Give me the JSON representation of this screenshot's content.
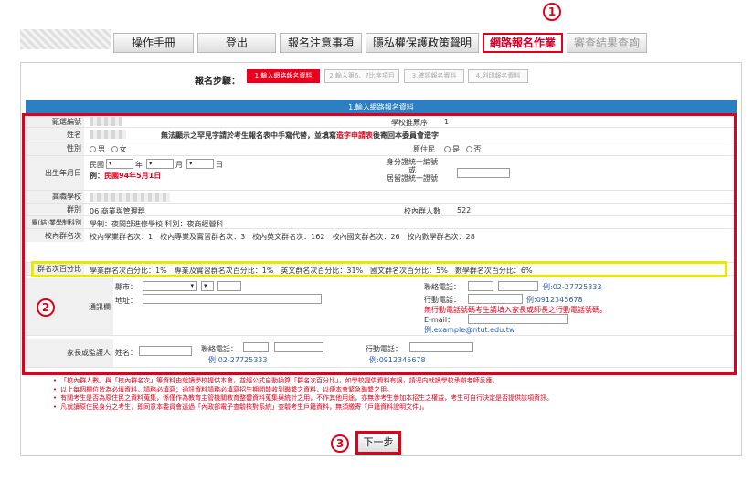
{
  "nav": {
    "items": [
      {
        "label": "操作手冊"
      },
      {
        "label": "登出"
      },
      {
        "label": "報名注意事項"
      },
      {
        "label": "隱私權保護政策聲明"
      },
      {
        "label": "網路報名作業"
      },
      {
        "label": "審查結果查詢"
      }
    ],
    "active_item": "網路報名作業"
  },
  "callouts": {
    "one": "1",
    "two": "2",
    "three": "3"
  },
  "steps": {
    "label": "報名步驟：",
    "items": [
      {
        "label": "1.輸入網路報名資料"
      },
      {
        "label": "2.輸入第6、7比序項目"
      },
      {
        "label": "3.確認報名資料"
      },
      {
        "label": "4.列印報名資料"
      }
    ]
  },
  "form": {
    "header": "1.輸入網路報名資料",
    "exam_no": {
      "label": "甄選編號",
      "school_rank_label": "學校推薦序",
      "school_rank": "1"
    },
    "name": {
      "label": "姓名",
      "note_black": "無法顯示之罕見字請於考生報名表中手寫代替，並填寫",
      "note_red": "造字申請表",
      "note_tail": "後寄回本委員會造字"
    },
    "gender": {
      "label": "性別",
      "male": "男",
      "female": "女",
      "aborigine_label": "原住民",
      "yes": "是",
      "no": "否"
    },
    "birth": {
      "label": "出生年月日",
      "era": "民國",
      "year": "年",
      "month": "月",
      "day": "日",
      "example_prefix": "例：",
      "example_red": "民國94年5月1日",
      "id_label_1": "身分證統一編號",
      "id_label_2": "或",
      "id_label_3": "居留證統一證號"
    },
    "school": {
      "label": "高職學校"
    },
    "group": {
      "label": "群別",
      "value": "06 商業與管理群",
      "count_label": "校內群人數",
      "count": "522"
    },
    "dept": {
      "label": "畢(結)業學制科別",
      "value": "學制：夜間部進修學校 科別：夜商經營科"
    },
    "rank": {
      "label": "校內群名次",
      "text": "校內學業群名次：1　校內專業及實習群名次：3　校內英文群名次：162　校內國文群名次：26　校內數學群名次：28"
    },
    "percent": {
      "label": "群名次百分比",
      "text": "學業群名次百分比：1%　專業及實習群名次百分比：1%　英文群名次百分比：31%　國文群名次百分比：5%　數學群名次百分比：6%"
    },
    "contact": {
      "label": "通訊欄",
      "city": "縣市：",
      "address": "地址：",
      "tel": "聯絡電話：",
      "tel_example": "例:02-27725333",
      "mobile": "行動電話：",
      "mobile_example": "例:0912345678",
      "mobile_note_1": "無行動電話號碼考生請填入家長或師長之行動電話號碼。",
      "email": "E-mail：",
      "email_example": "例:example@ntut.edu.tw"
    },
    "guardian": {
      "label": "家長或監護人",
      "name": "姓名：",
      "tel": "聯絡電話：",
      "tel_example": "例:02-27725333",
      "mobile": "行動電話：",
      "mobile_example": "例:0912345678"
    }
  },
  "notes": [
    "「校內群人數」與「校內群名次」等資料由就讀學校提供本會，並經公式自動換算「群名次百分比」，如學校提供資料有誤，請逕向就讀學校承辦老師反應。",
    "以上每個欄位皆為必填資料，請務必填寫；通訊資料請務必填寫招生期間能收到聯繫之資料，以便本會緊急聯繫之用。",
    "有關考生是否為原住民之資料蒐集，係僅作為教育主管機關教育整體資料蒐集與統計之用，不作其他用途，亦無涉考生參加本招生之權益，考生可自行決定是否提供該項資訊。",
    "凡就讀原住民身分之考生，即同意本委員會透過「內政部電子查驗核對系統」查驗考生戶籍資料，無須繳寄「戶籍資料證明文件」。"
  ],
  "next_button": "下一步",
  "colors": {
    "accent_red": "#e0001a",
    "header_blue": "#2c7fc3",
    "highlight_yellow": "#eaea00"
  }
}
